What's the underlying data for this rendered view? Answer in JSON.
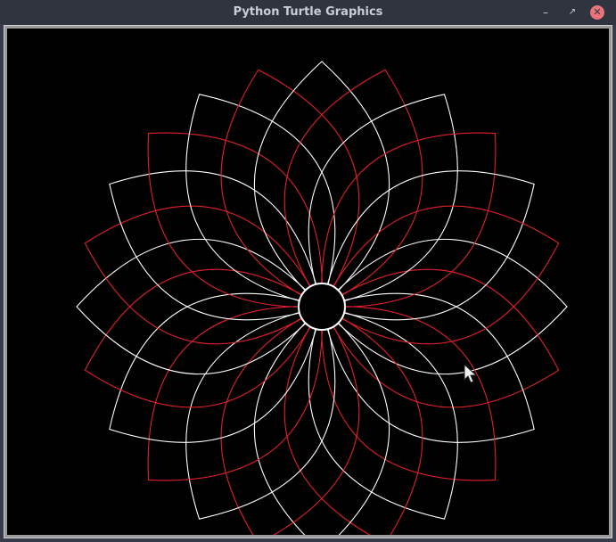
{
  "window": {
    "title": "Python Turtle Graphics",
    "controls": {
      "minimize": "minimize-icon",
      "maximize": "maximize-icon",
      "close": "close-icon"
    }
  },
  "canvas": {
    "background": "#000000",
    "pattern": {
      "petal_count": 24,
      "colors": [
        "#ffffff",
        "#e0202a"
      ],
      "center_disc_color": "#ffffff"
    }
  }
}
